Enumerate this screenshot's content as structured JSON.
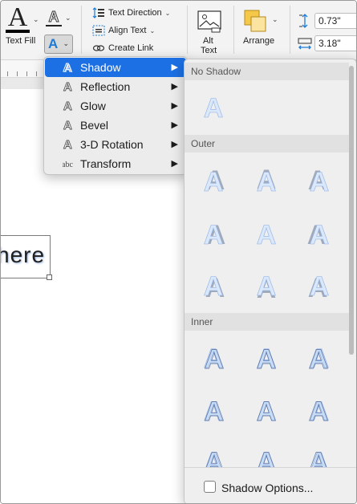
{
  "ribbon": {
    "text_fill_glyph": "A",
    "text_fill_label": "Text Fill",
    "text_outline_glyph": "A",
    "text_effects_glyph": "A",
    "text_direction_label": "Text Direction",
    "align_text_label": "Align Text",
    "create_link_label": "Create Link",
    "alt_text_label_line1": "Alt",
    "alt_text_label_line2": "Text",
    "arrange_label": "Arrange",
    "height_value": "0.73\"",
    "width_value": "3.18\"",
    "accent_color": "#1d7bd6"
  },
  "document": {
    "textbox_text": "here"
  },
  "effects_menu": {
    "items": [
      {
        "label": "Shadow",
        "icon": "shadow-effect-icon",
        "active": true
      },
      {
        "label": "Reflection",
        "icon": "reflection-effect-icon",
        "active": false
      },
      {
        "label": "Glow",
        "icon": "glow-effect-icon",
        "active": false
      },
      {
        "label": "Bevel",
        "icon": "bevel-effect-icon",
        "active": false
      },
      {
        "label": "3-D Rotation",
        "icon": "3d-rotation-effect-icon",
        "active": false
      },
      {
        "label": "Transform",
        "icon": "transform-effect-icon",
        "active": false
      }
    ],
    "highlight_color": "#1d70e3"
  },
  "shadow_gallery": {
    "sections": [
      {
        "title": "No Shadow",
        "count": 1
      },
      {
        "title": "Outer",
        "count": 9
      },
      {
        "title": "Inner",
        "count": 9
      }
    ],
    "sample_glyph": "A",
    "footer_option": "Shadow Options..."
  }
}
